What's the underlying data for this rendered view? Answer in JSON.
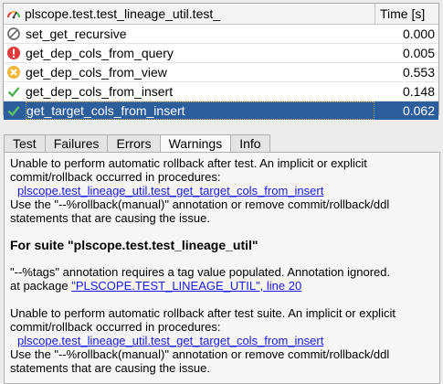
{
  "grid": {
    "header_name": "plscope.test.test_lineage_util.test_",
    "header_time": "Time [s]",
    "rows": [
      {
        "name": "set_get_recursive",
        "time": "0.000",
        "status_icon": "skipped-icon"
      },
      {
        "name": "get_dep_cols_from_query",
        "time": "0.005",
        "status_icon": "error-icon"
      },
      {
        "name": "get_dep_cols_from_view",
        "time": "0.553",
        "status_icon": "failure-icon"
      },
      {
        "name": "get_dep_cols_from_insert",
        "time": "0.148",
        "status_icon": "success-icon"
      },
      {
        "name": "get_target_cols_from_insert",
        "time": "0.062",
        "status_icon": "success-icon"
      }
    ],
    "selected_row": 4
  },
  "tabs": [
    {
      "label": "Test"
    },
    {
      "label": "Failures"
    },
    {
      "label": "Errors"
    },
    {
      "label": "Warnings"
    },
    {
      "label": "Info"
    }
  ],
  "active_tab": "Warnings",
  "warnings": {
    "w1_line1": "Unable to perform automatic rollback after test. An implicit or explicit",
    "w1_line2": "commit/rollback occurred in procedures:",
    "w1_link": "plscope.test_lineage_util.test_get_target_cols_from_insert",
    "w1_line3": "Use the \"--%rollback(manual)\" annotation or remove commit/rollback/ddl",
    "w1_line4": "statements that are causing the issue.",
    "suite_heading": "For suite \"plscope.test.test_lineage_util\"",
    "w2_line1": "\"--%tags\" annotation requires a tag value populated. Annotation ignored.",
    "w2_prefix": "at package ",
    "w2_link": "\"PLSCOPE.TEST_LINEAGE_UTIL\", line 20",
    "w3_line1": "Unable to perform automatic rollback after test suite. An implicit or explicit",
    "w3_line2": "commit/rollback occurred in procedures:",
    "w3_link": "plscope.test_lineage_util.test_get_target_cols_from_insert",
    "w3_line3": "Use the \"--%rollback(manual)\" annotation or remove commit/rollback/ddl",
    "w3_line4": "statements that are causing the issue."
  },
  "colors": {
    "selection": "#2c5e9e",
    "link": "#1a1ae6",
    "error": "#e03a3a",
    "failure": "#f0b63a",
    "success": "#4caf50",
    "skipped": "#6e6e6e"
  }
}
